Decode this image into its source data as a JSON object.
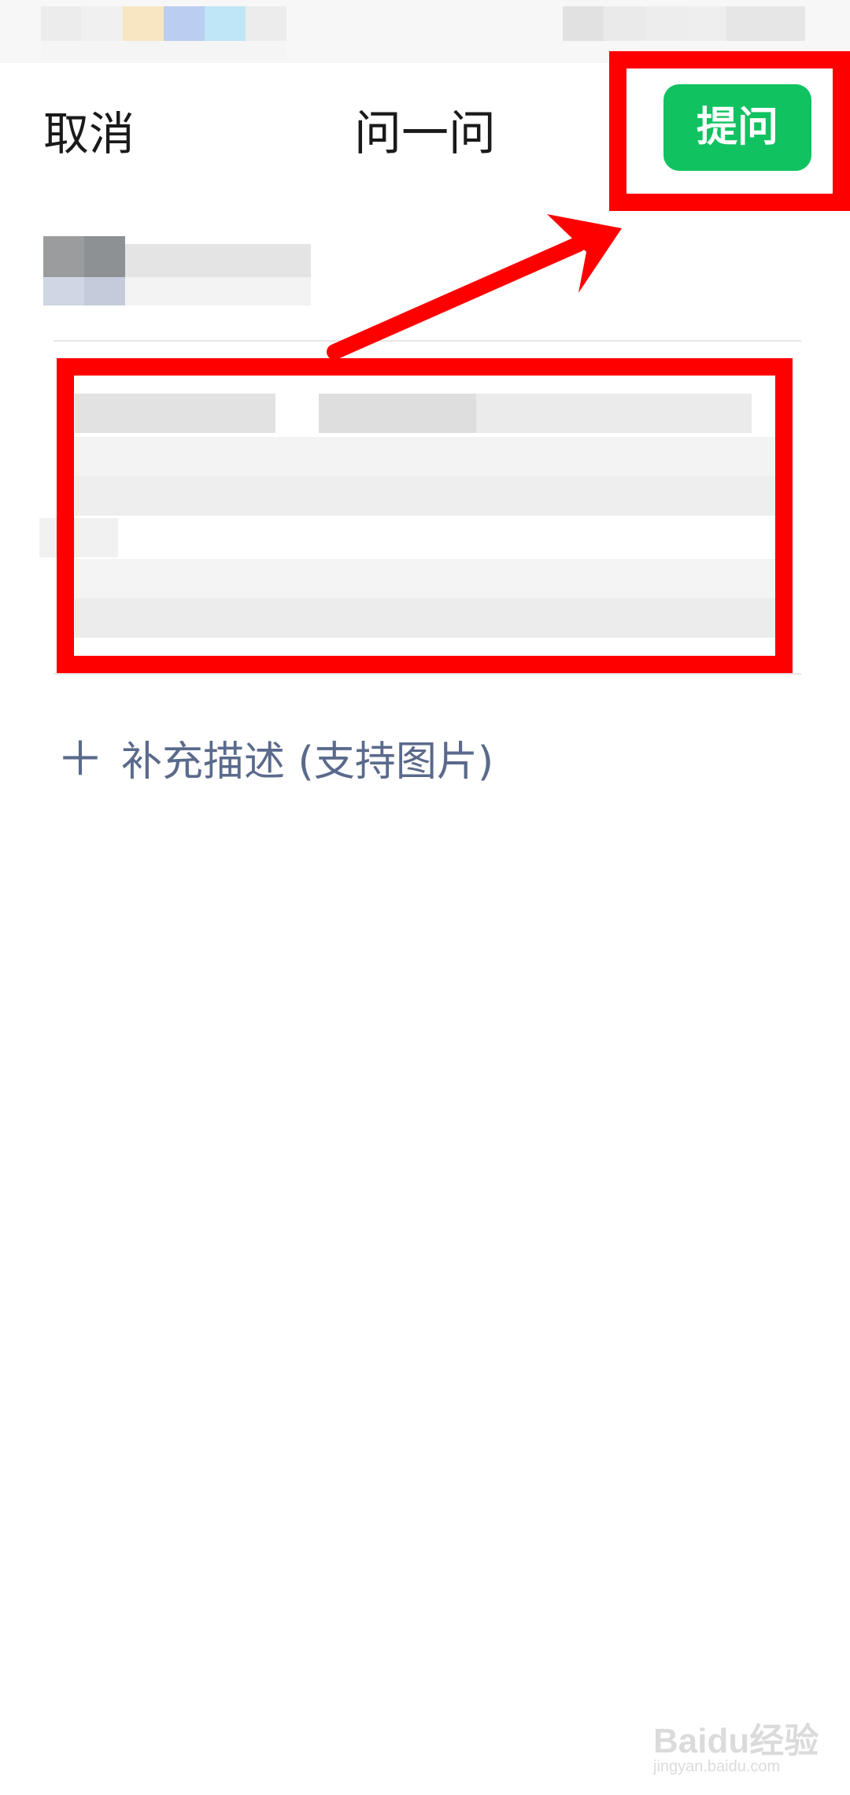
{
  "header": {
    "cancel_label": "取消",
    "title": "问一问",
    "ask_label": "提问"
  },
  "composer": {
    "supplement_plus": "＋",
    "supplement_label": "补充描述 (支持图片)"
  },
  "watermark": {
    "logo": "Baidu经验",
    "url": "jingyan.baidu.com"
  },
  "colors": {
    "accent_green": "#11c261",
    "annotation_red": "#ff0000",
    "link_text": "#5a6a8c"
  }
}
